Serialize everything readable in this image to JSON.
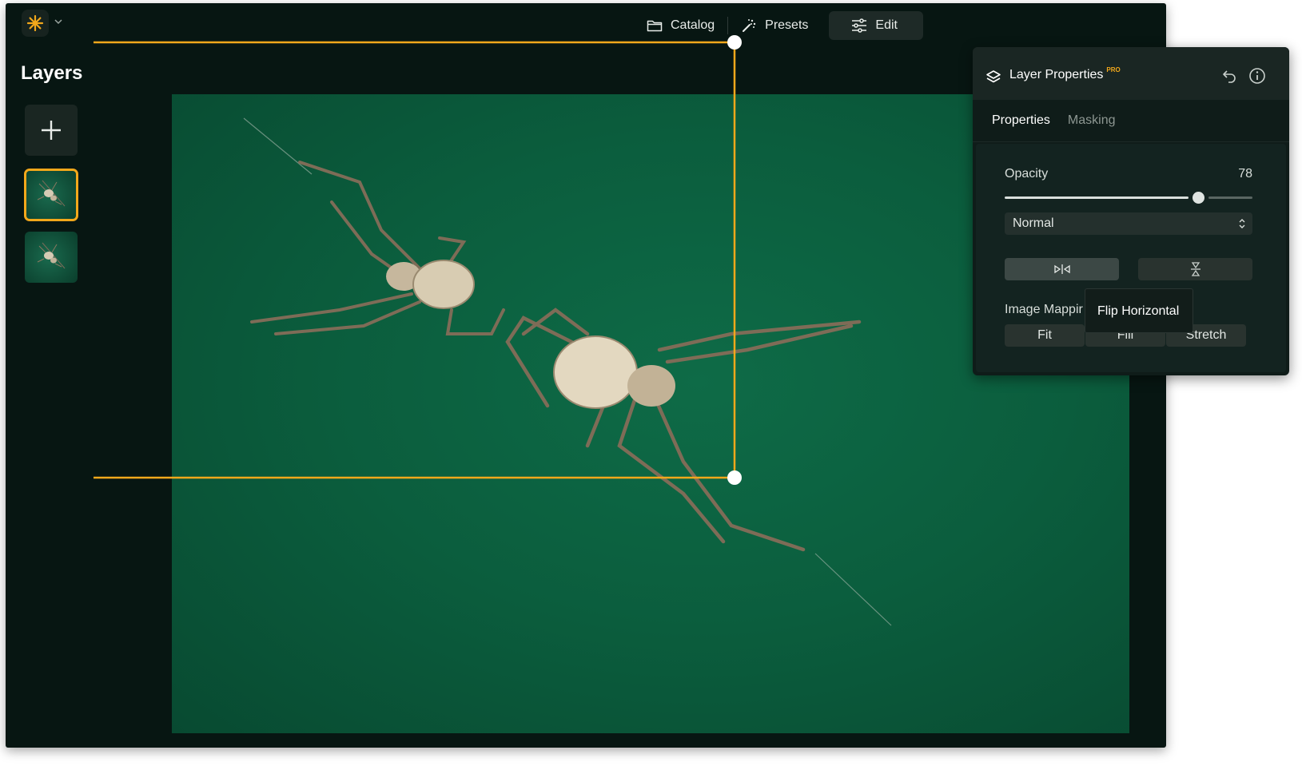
{
  "topbar": {
    "nav": [
      {
        "label": "Catalog",
        "icon": "folder-icon"
      },
      {
        "label": "Presets",
        "icon": "magic-wand-icon"
      },
      {
        "label": "Edit",
        "icon": "sliders-icon",
        "active": true
      }
    ],
    "brand_color": "#f2a81b"
  },
  "layers": {
    "title": "Layers",
    "selected_index": 0
  },
  "panel": {
    "title": "Layer Properties",
    "badge": "PRO",
    "tabs": [
      "Properties",
      "Masking"
    ],
    "active_tab": "Properties",
    "opacity": {
      "label": "Opacity",
      "value": "78",
      "level": 0.78
    },
    "blend_mode": "Normal",
    "mapping": {
      "label": "Image Mappir",
      "options": [
        "Fit",
        "Fill",
        "Stretch"
      ]
    }
  },
  "tooltip": {
    "text": "Flip Horizontal"
  },
  "colors": {
    "accent": "#f2a81b",
    "canvas_green": "#0b5d3d",
    "panel_bg": "#0f1c19"
  }
}
